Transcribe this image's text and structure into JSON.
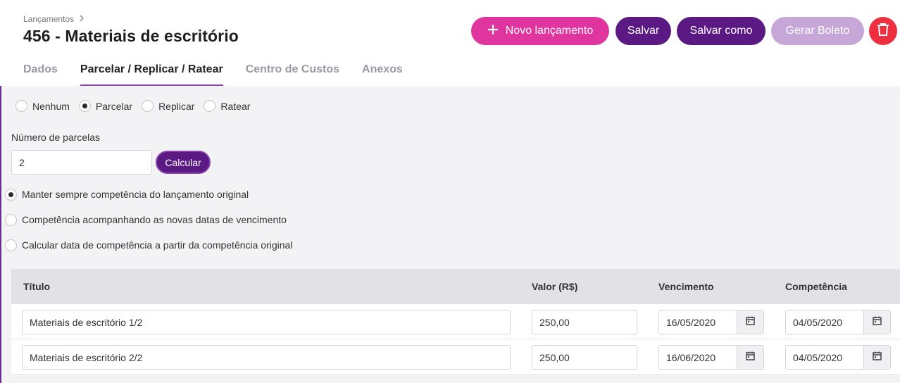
{
  "header": {
    "breadcrumb": "Lançamentos",
    "title": "456 - Materiais de escritório"
  },
  "actions": {
    "new_label": "Novo lançamento",
    "save_label": "Salvar",
    "save_as_label": "Salvar como",
    "boleto_label": "Gerar Boleto"
  },
  "tabs": [
    {
      "label": "Dados"
    },
    {
      "label": "Parcelar / Replicar / Ratear"
    },
    {
      "label": "Centro de Custos"
    },
    {
      "label": "Anexos"
    }
  ],
  "modes": {
    "selected": "Parcelar",
    "options": [
      {
        "label": "Nenhum"
      },
      {
        "label": "Parcelar"
      },
      {
        "label": "Replicar"
      },
      {
        "label": "Ratear"
      }
    ]
  },
  "parcelas": {
    "label": "Número de parcelas",
    "value": "2",
    "calc_label": "Calcular"
  },
  "competencia_options": [
    {
      "label": "Manter sempre competência do lançamento original"
    },
    {
      "label": "Competência acompanhando as novas datas de vencimento"
    },
    {
      "label": "Calcular data de competência a partir da competência original"
    }
  ],
  "table": {
    "headers": [
      "Título",
      "Valor (R$)",
      "Vencimento",
      "Competência"
    ],
    "rows": [
      {
        "titulo": "Materiais de escritório 1/2",
        "valor": "250,00",
        "vencimento": "16/05/2020",
        "competencia": "04/05/2020"
      },
      {
        "titulo": "Materiais de escritório 2/2",
        "valor": "250,00",
        "vencimento": "16/06/2020",
        "competencia": "04/05/2020"
      }
    ]
  },
  "colors": {
    "primary": "#5b1a83",
    "accent_pink": "#e0349e",
    "disabled": "#c6a7d8",
    "danger": "#ee2f3f"
  },
  "icons": {
    "breadcrumb": "chevron-right-icon",
    "new": "plus-icon",
    "delete": "trash-icon",
    "date": "calendar-icon"
  }
}
